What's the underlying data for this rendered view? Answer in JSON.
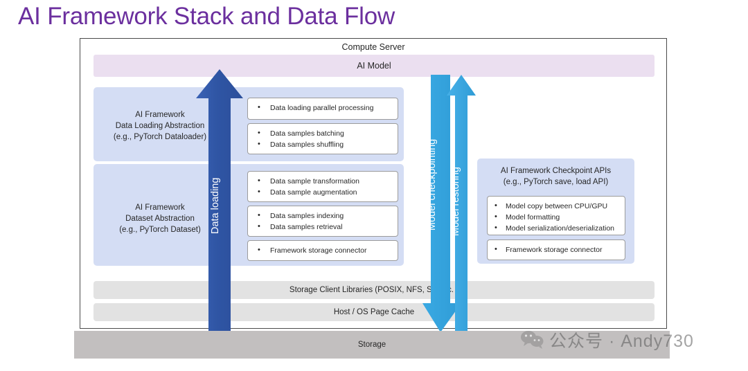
{
  "title": "AI Framework Stack and Data Flow",
  "colors": {
    "title_purple": "#6b2f9e",
    "panel_blue": "#d4ddf4",
    "ai_model_lavender": "#ebdff0",
    "arrow_dark_blue": "#2f55a4",
    "arrow_cyan": "#33a5e0",
    "grey_bar": "#e2e2e2",
    "storage_grey": "#c2bfbf"
  },
  "diagram": {
    "container_label": "Compute Server",
    "ai_model_label": "AI Model",
    "panels": {
      "data_loading": {
        "label": "AI Framework\nData Loading Abstraction\n(e.g., PyTorch Dataloader)",
        "label_lines": [
          "AI Framework",
          "Data Loading Abstraction",
          "(e.g., PyTorch Dataloader)"
        ],
        "boxes": [
          {
            "items": [
              "Data loading parallel processing"
            ]
          },
          {
            "items": [
              "Data samples batching",
              "Data samples shuffling"
            ]
          }
        ]
      },
      "dataset": {
        "label_lines": [
          "AI Framework",
          "Dataset Abstraction",
          "(e.g., PyTorch Dataset)"
        ],
        "boxes": [
          {
            "items": [
              "Data sample transformation",
              "Data sample augmentation"
            ]
          },
          {
            "items": [
              "Data samples indexing",
              "Data samples retrieval"
            ]
          },
          {
            "items": [
              "Framework storage connector"
            ]
          }
        ]
      },
      "checkpoint": {
        "label_lines": [
          "AI Framework Checkpoint APIs",
          "(e.g., PyTorch save, load API)"
        ],
        "boxes": [
          {
            "items": [
              "Model copy between CPU/GPU",
              "Model formatting",
              "Model serialization/deserialization"
            ]
          },
          {
            "items": [
              "Framework storage connector"
            ]
          }
        ]
      }
    },
    "grey_bars": [
      "Storage Client Libraries (POSIX, NFS, S3, etc. )",
      "Host / OS Page Cache"
    ],
    "storage_footer_label": "Storage",
    "arrows": [
      {
        "name": "data-loading",
        "label": "Data loading",
        "direction": "up",
        "color": "#2f55a4"
      },
      {
        "name": "model-checkpointing",
        "label": "Model checkpointing",
        "direction": "down",
        "color": "#33a5e0"
      },
      {
        "name": "model-restoring",
        "label": "Model restoring",
        "direction": "up",
        "color": "#33a5e0"
      }
    ]
  },
  "watermark": {
    "icon": "wechat-icon",
    "text": "公众号 · Andy730"
  }
}
